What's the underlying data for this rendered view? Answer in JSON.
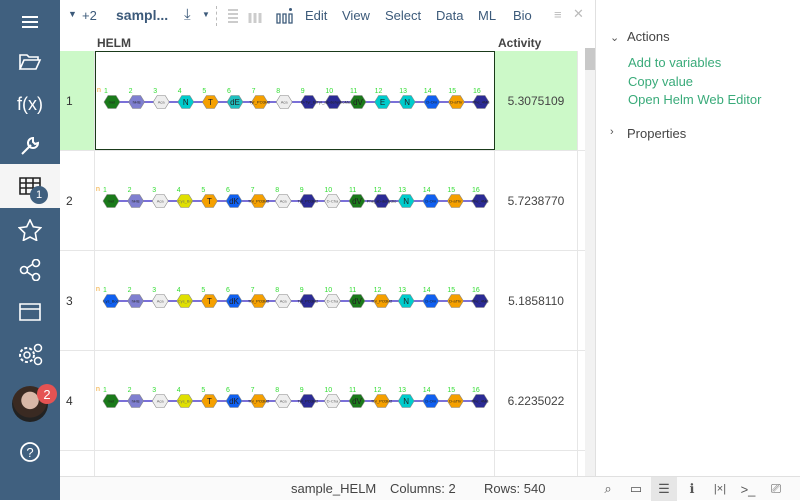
{
  "sidebar": {
    "items": [
      {
        "icon": "hamburger-icon"
      },
      {
        "icon": "folder-icon"
      },
      {
        "icon": "function-icon",
        "label": "f(x)"
      },
      {
        "icon": "wrench-icon"
      },
      {
        "icon": "table-icon",
        "badge": "1"
      },
      {
        "icon": "star-icon"
      },
      {
        "icon": "share-icon"
      },
      {
        "icon": "window-icon"
      },
      {
        "icon": "settings-icon"
      },
      {
        "icon": "avatar",
        "badge": "2"
      },
      {
        "icon": "help-icon",
        "label": "?"
      }
    ]
  },
  "toolbar": {
    "tabs_more": "+2",
    "title": "sampl...",
    "menus": [
      "Edit",
      "View",
      "Select",
      "Data",
      "ML",
      "Bio"
    ]
  },
  "grid": {
    "columns": [
      "HELM",
      "Activity"
    ],
    "rows": [
      {
        "n": "1",
        "activity": "5.3075109",
        "monomers": [
          [
            "meI",
            "#1a7a1a"
          ],
          [
            "hHis",
            "#7f7fd0"
          ],
          [
            "Aca",
            "#eeeeee"
          ],
          [
            "N",
            "#00cccc"
          ],
          [
            "T",
            "#f5a000"
          ],
          [
            "dE",
            "#1fbfbf"
          ],
          [
            "Tyr_PO3H2",
            "#f5a000"
          ],
          [
            "Aca",
            "#eeeeee"
          ],
          [
            "D-Tyr_Et",
            "#2b2b95"
          ],
          [
            "Tyr_ab-dehydroMe",
            "#2b2b95"
          ],
          [
            "dV",
            "#1a7a1a"
          ],
          [
            "E",
            "#00cccc"
          ],
          [
            "N",
            "#00cccc"
          ],
          [
            "D-Orn",
            "#1060f0"
          ],
          [
            "D-aThr",
            "#f5a000"
          ],
          [
            "Phe_4Me",
            "#2b2b95"
          ]
        ]
      },
      {
        "n": "2",
        "activity": "5.7238770",
        "monomers": [
          [
            "meI",
            "#1a7a1a"
          ],
          [
            "hHis",
            "#7f7fd0"
          ],
          [
            "Aca",
            "#eeeeee"
          ],
          [
            "Cys_Bn",
            "#e0e000"
          ],
          [
            "T",
            "#f5a000"
          ],
          [
            "dK",
            "#1060f0"
          ],
          [
            "Thr_PO3H2",
            "#f5a000"
          ],
          [
            "Aca",
            "#eeeeee"
          ],
          [
            "Tyr_PO3H2",
            "#2b2b95"
          ],
          [
            "D-Cha",
            "#eeeeee"
          ],
          [
            "dV",
            "#1a7a1a"
          ],
          [
            "Phe_ab-dehydro",
            "#2b2b95"
          ],
          [
            "N",
            "#00cccc"
          ],
          [
            "D-Orn",
            "#1060f0"
          ],
          [
            "D-aThr",
            "#f5a000"
          ],
          [
            "Phe_4Me",
            "#2b2b95"
          ]
        ]
      },
      {
        "n": "3",
        "activity": "5.1858110",
        "monomers": [
          [
            "Lys_Boc",
            "#1060f0"
          ],
          [
            "hHis",
            "#7f7fd0"
          ],
          [
            "Aca",
            "#eeeeee"
          ],
          [
            "Cys_Bn",
            "#e0e000"
          ],
          [
            "T",
            "#f5a000"
          ],
          [
            "dK",
            "#1060f0"
          ],
          [
            "Thr_PO3H2",
            "#f5a000"
          ],
          [
            "Aca",
            "#eeeeee"
          ],
          [
            "Tyr_PO3H2",
            "#2b2b95"
          ],
          [
            "D-Cha",
            "#eeeeee"
          ],
          [
            "dV",
            "#1a7a1a"
          ],
          [
            "Thr_PO3H2",
            "#f5a000"
          ],
          [
            "N",
            "#00cccc"
          ],
          [
            "D-Orn",
            "#1060f0"
          ],
          [
            "D-aThr",
            "#f5a000"
          ],
          [
            "Phe_4Me",
            "#2b2b95"
          ]
        ]
      },
      {
        "n": "4",
        "activity": "6.2235022",
        "monomers": [
          [
            "meI",
            "#1a7a1a"
          ],
          [
            "hHis",
            "#7f7fd0"
          ],
          [
            "Aca",
            "#eeeeee"
          ],
          [
            "Cys_Bn",
            "#e0e000"
          ],
          [
            "T",
            "#f5a000"
          ],
          [
            "dK",
            "#1060f0"
          ],
          [
            "Thr_PO3H2",
            "#f5a000"
          ],
          [
            "Aca",
            "#eeeeee"
          ],
          [
            "Tyr_PO3H2",
            "#2b2b95"
          ],
          [
            "D-Cha",
            "#eeeeee"
          ],
          [
            "dV",
            "#1a7a1a"
          ],
          [
            "Thr_PO3H2",
            "#f5a000"
          ],
          [
            "N",
            "#00cccc"
          ],
          [
            "D-Orn",
            "#1060f0"
          ],
          [
            "D-aThr",
            "#f5a000"
          ],
          [
            "Phe_4Me",
            "#2b2b95"
          ]
        ]
      }
    ]
  },
  "panel": {
    "actions": "Actions",
    "links": [
      "Add to variables",
      "Copy value",
      "Open Helm Web Editor"
    ],
    "properties": "Properties"
  },
  "status": {
    "table": "sample_HELM",
    "columns": "Columns: 2",
    "rows": "Rows: 540",
    "icons": [
      "search-icon",
      "layout-icon",
      "settings-sliders-icon",
      "info-icon",
      "variables-icon",
      "console-icon",
      "presentation-icon"
    ]
  },
  "colors": {
    "sidebar": "#40607f",
    "selected_row": "#ccf9c8",
    "link": "#3aab7a",
    "position_label": "#33dd33"
  }
}
